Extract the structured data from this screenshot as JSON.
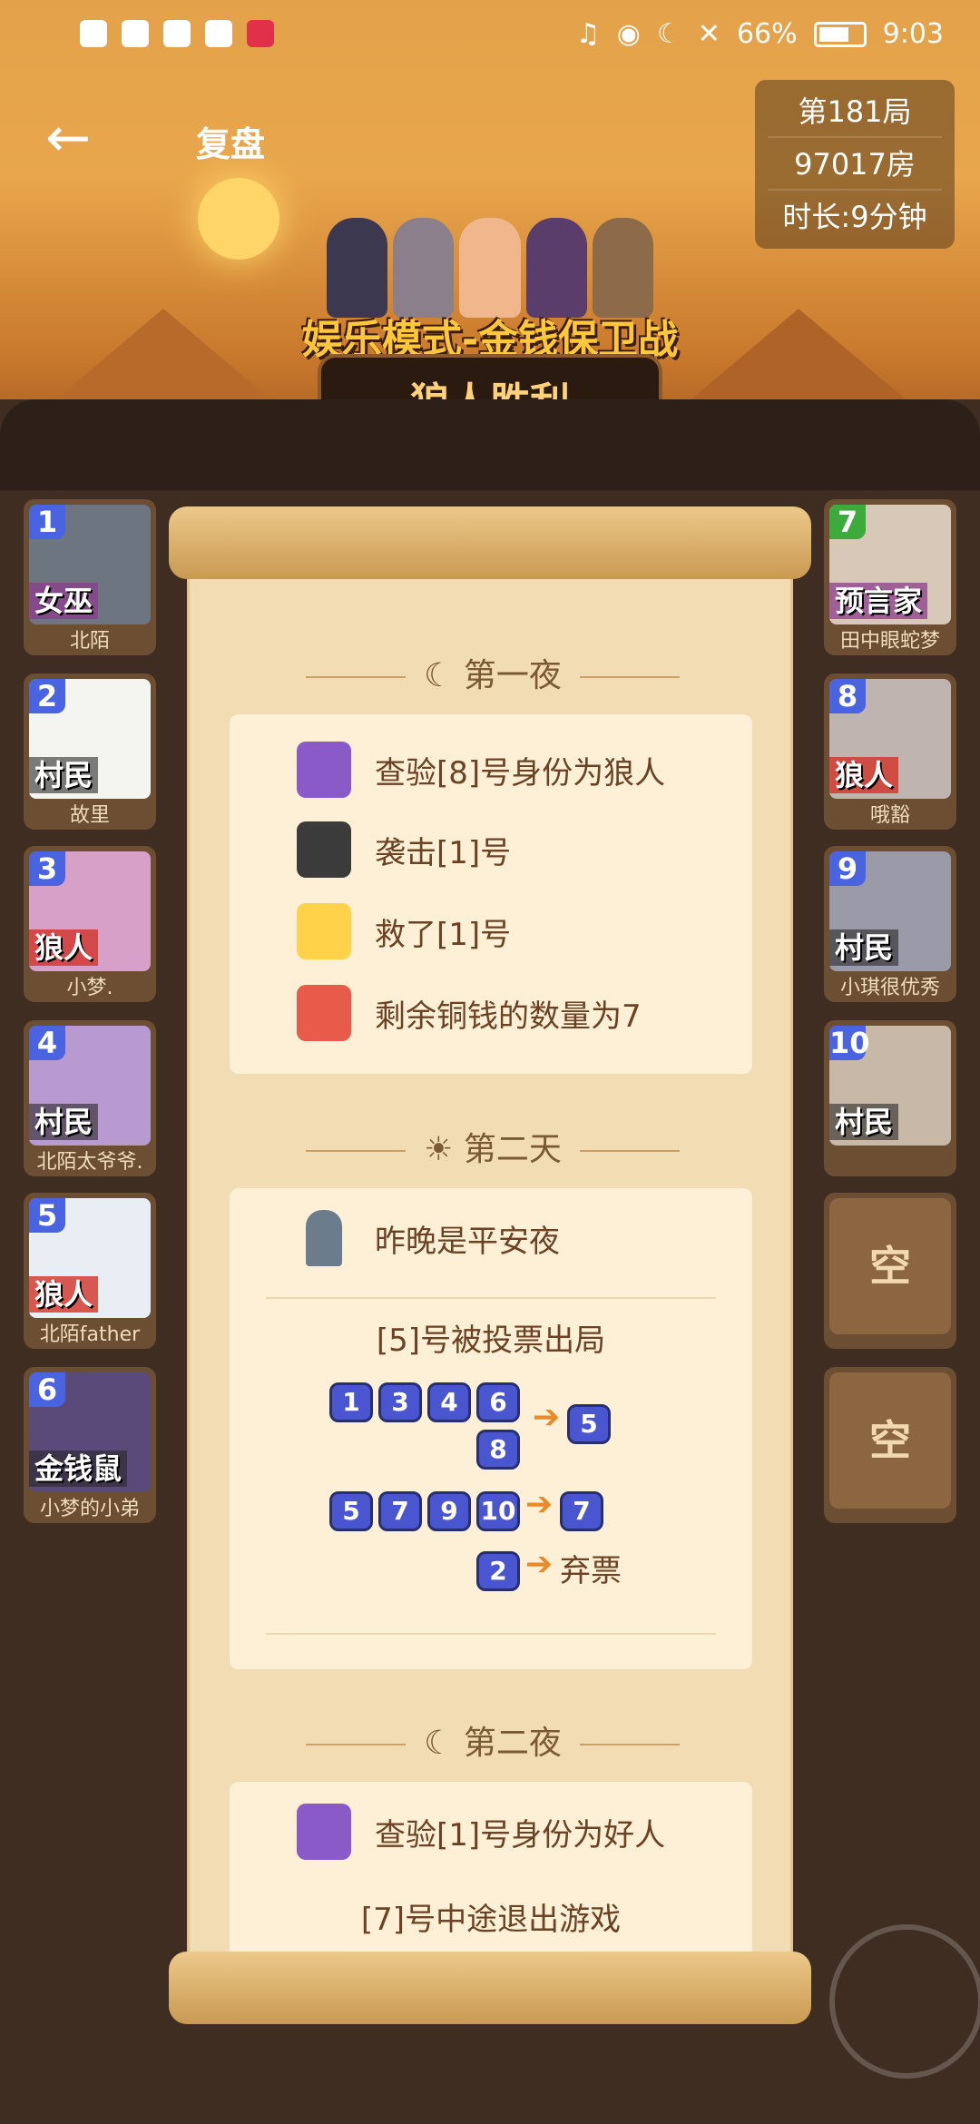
{
  "status_bar": {
    "battery": "66%",
    "time": "9:03"
  },
  "header": {
    "back_icon": "arrow-left-icon",
    "title": "复盘"
  },
  "game_info": {
    "round": "第181局",
    "room": "97017房",
    "duration": "时长:9分钟"
  },
  "mode": {
    "name": "娱乐模式-金钱保卫战",
    "result": "狼人胜利"
  },
  "players_left": [
    {
      "num": "1",
      "role": "女巫",
      "nick": "北陌"
    },
    {
      "num": "2",
      "role": "村民",
      "nick": "故里"
    },
    {
      "num": "3",
      "role": "狼人",
      "nick": "小梦."
    },
    {
      "num": "4",
      "role": "村民",
      "nick": "北陌太爷爷."
    },
    {
      "num": "5",
      "role": "狼人",
      "nick": "北陌father"
    },
    {
      "num": "6",
      "role": "金钱鼠",
      "nick": "小梦的小弟"
    }
  ],
  "players_right": [
    {
      "num": "7",
      "role": "预言家",
      "nick": "田中眼蛇梦"
    },
    {
      "num": "8",
      "role": "狼人",
      "nick": "哦豁"
    },
    {
      "num": "9",
      "role": "村民",
      "nick": "小琪很优秀"
    },
    {
      "num": "10",
      "role": "村民",
      "nick": ""
    }
  ],
  "empty_seats": [
    "空",
    "空"
  ],
  "night1": {
    "title": "第一夜",
    "events": [
      "查验[8]号身份为狼人",
      "袭击[1]号",
      "救了[1]号",
      "剩余铜钱的数量为7"
    ]
  },
  "day2": {
    "title": "第二天",
    "peace": "昨晚是平安夜",
    "vote_result": "[5]号被投票出局",
    "vote_rows": [
      {
        "voters": [
          "1",
          "3",
          "4",
          "6",
          "8"
        ],
        "target": "5"
      },
      {
        "voters": [
          "5",
          "7",
          "9",
          "10"
        ],
        "target": "7"
      },
      {
        "voters": [
          "2"
        ],
        "target": "弃票"
      }
    ]
  },
  "night2": {
    "title": "第二夜",
    "events": [
      "查验[1]号身份为好人",
      "[7]号中途退出游戏"
    ]
  }
}
